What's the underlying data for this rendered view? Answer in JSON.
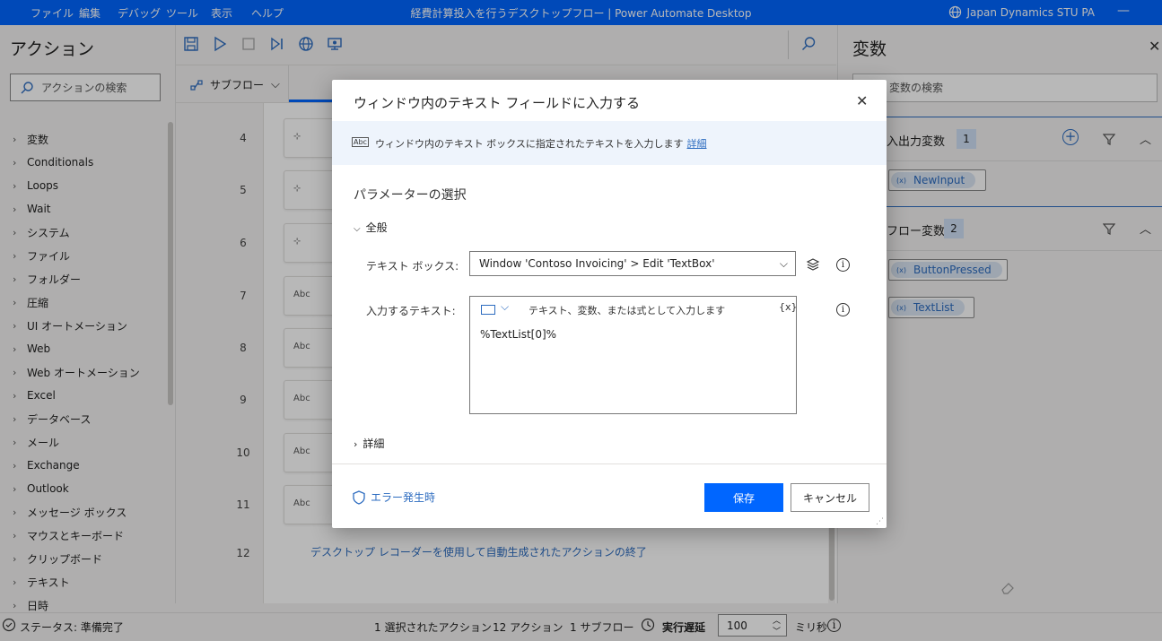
{
  "titlebar": {
    "menus": [
      "ファイル",
      "編集",
      "デバッグ",
      "ツール",
      "表示",
      "ヘルプ"
    ],
    "title": "経費計算投入を行うデスクトップフロー | Power Automate Desktop",
    "user": "Japan Dynamics STU PA",
    "minimize": "—"
  },
  "actions_panel": {
    "title": "アクション",
    "search_placeholder": "アクションの検索",
    "items": [
      "変数",
      "Conditionals",
      "Loops",
      "Wait",
      "システム",
      "ファイル",
      "フォルダー",
      "圧縮",
      "UI オートメーション",
      "Web",
      "Web オートメーション",
      "Excel",
      "データベース",
      "メール",
      "Exchange",
      "Outlook",
      "メッセージ ボックス",
      "マウスとキーボード",
      "クリップボード",
      "テキスト",
      "日時"
    ]
  },
  "editor": {
    "subflow_tab": "サブフロー",
    "line_numbers": [
      "4",
      "5",
      "6",
      "7",
      "8",
      "9",
      "10",
      "11",
      "12"
    ],
    "end_text": "デスクトップ レコーダーを使用して自動生成されたアクションの終了"
  },
  "variables_panel": {
    "title": "変数",
    "search_placeholder": "変数の検索",
    "io_section": {
      "label": "入出力変数",
      "count": "1",
      "vars": [
        "NewInput"
      ]
    },
    "flow_section": {
      "label": "フロー変数",
      "count": "2",
      "vars": [
        "ButtonPressed",
        "TextList"
      ]
    }
  },
  "statusbar": {
    "status": "ステータス: 準備完了",
    "selected": "1 選択されたアクション",
    "actions": "12 アクション",
    "subflows": "1 サブフロー",
    "delay_label": "実行遅延",
    "delay_value": "100",
    "unit": "ミリ秒"
  },
  "dialog": {
    "title": "ウィンドウ内のテキスト フィールドに入力する",
    "description": "ウィンドウ内のテキスト ボックスに指定されたテキストを入力します",
    "details_link": "詳細",
    "params_title": "パラメーターの選択",
    "general_label": "全般",
    "textbox_label": "テキスト ボックス:",
    "textbox_value": "Window 'Contoso Invoicing' > Edit 'TextBox'",
    "input_label": "入力するテキスト:",
    "input_hint": "テキスト、変数、または式として入力します",
    "fx": "{x}",
    "input_value": "%TextList[0]%",
    "advanced_label": "詳細",
    "error_link": "エラー発生時",
    "save": "保存",
    "cancel": "キャンセル"
  },
  "colors": {
    "accent": "#0066ff",
    "link": "#2d6cc0"
  }
}
